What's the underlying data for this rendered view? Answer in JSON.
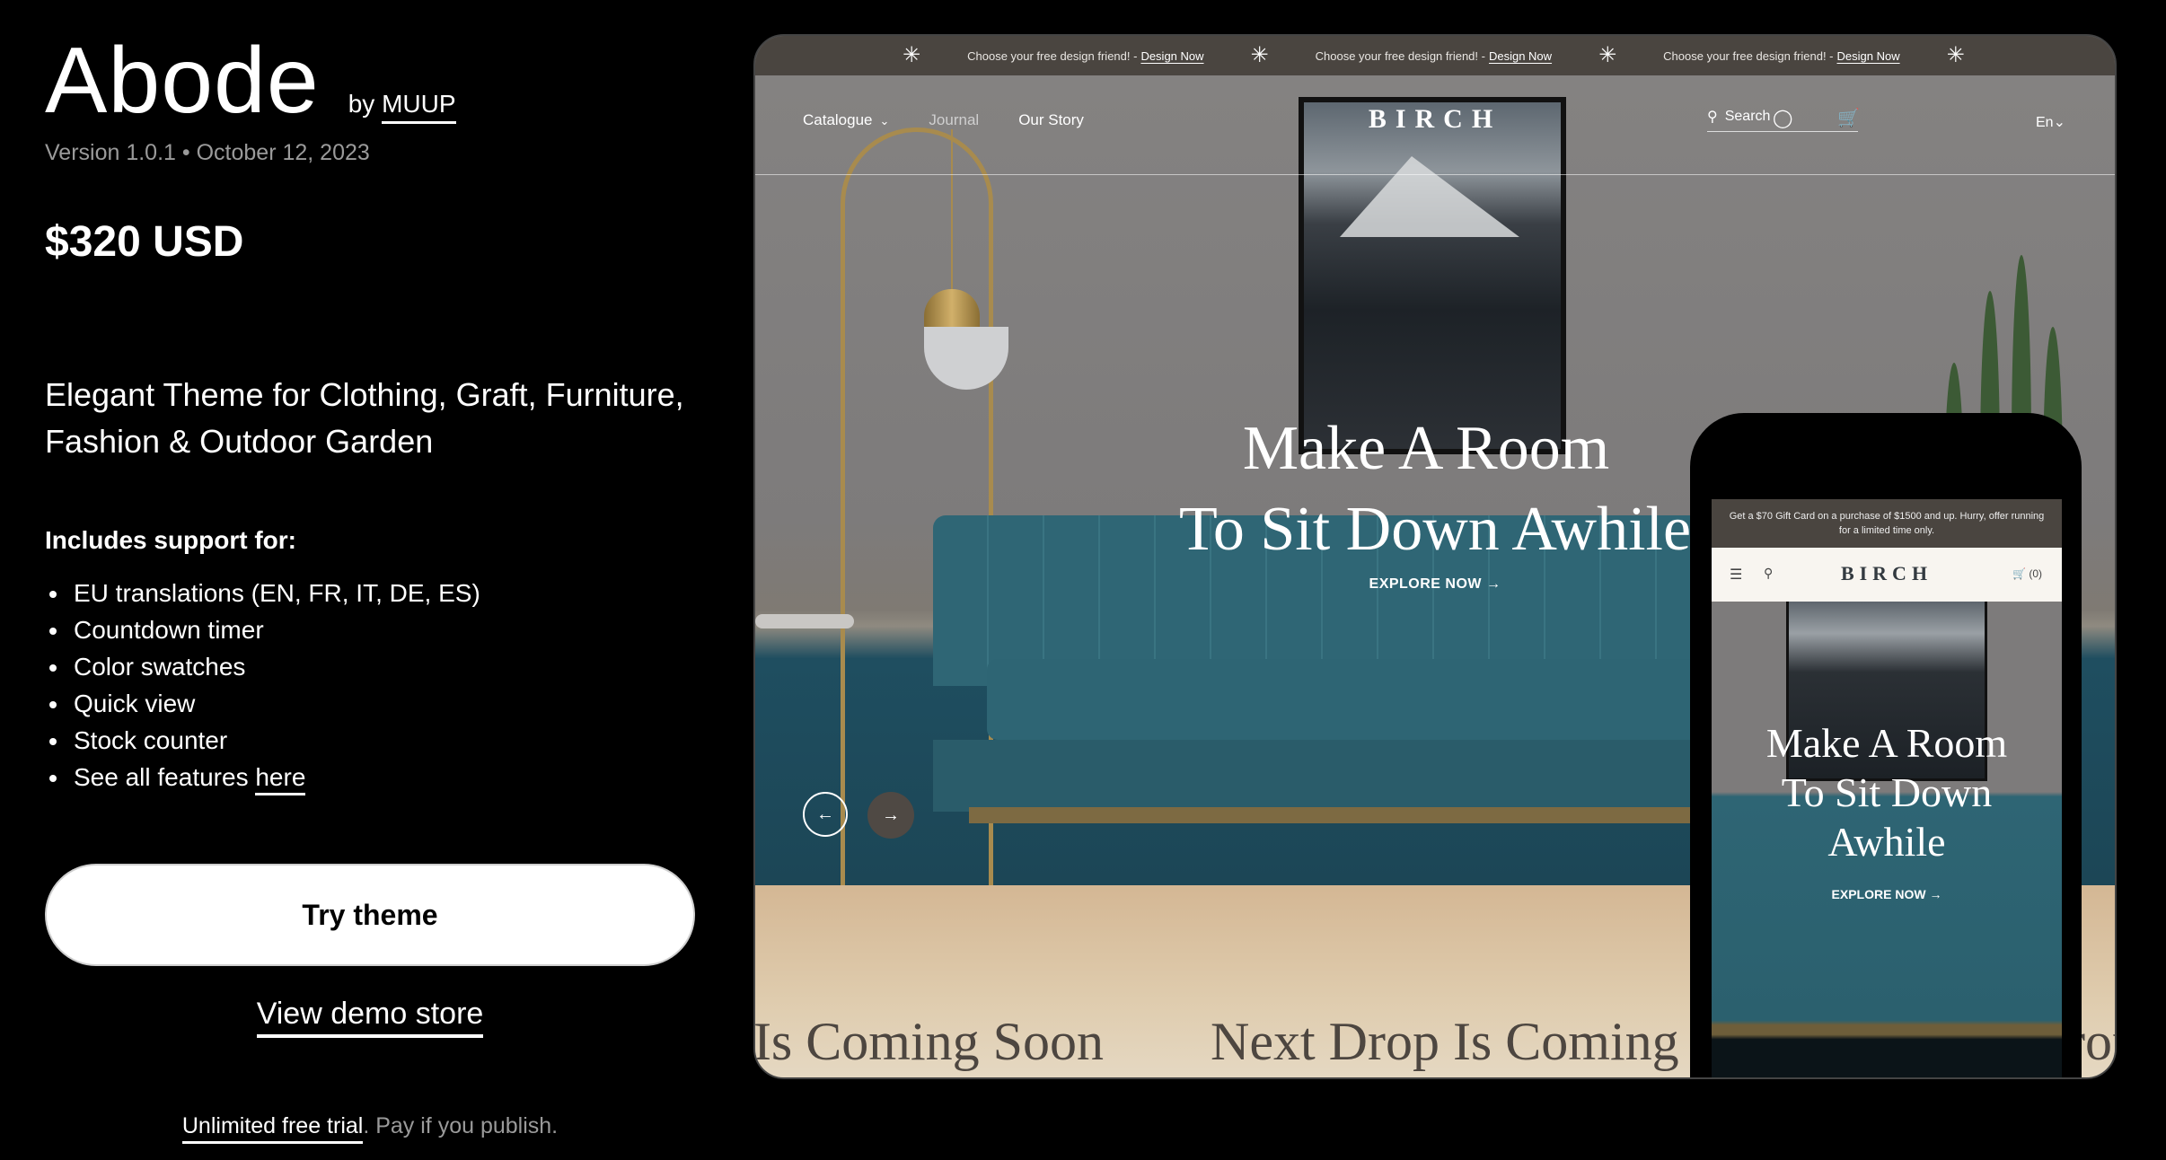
{
  "theme": {
    "name": "Abode",
    "by_prefix": "by",
    "author": "MUUP",
    "version": "Version 1.0.1",
    "separator": "•",
    "date": "October 12, 2023",
    "price": "$320 USD",
    "tagline": "Elegant Theme for Clothing, Graft, Furniture, Fashion & Outdoor Garden"
  },
  "support": {
    "heading": "Includes support for:",
    "features": [
      "EU translations (EN, FR, IT, DE, ES)",
      "Countdown timer",
      "Color swatches",
      "Quick view",
      "Stock counter"
    ],
    "see_all_prefix": "See all features",
    "see_all_link": "here"
  },
  "actions": {
    "try_theme": "Try theme",
    "view_demo": "View demo store",
    "trial_link": "Unlimited free trial",
    "trial_rest": ". Pay if you publish."
  },
  "preview": {
    "announcement": {
      "text": "Choose your free design friend! -",
      "link": "Design Now",
      "repeat_count": 3,
      "star_icon": "✳"
    },
    "nav": {
      "links": [
        "Catalogue",
        "Journal",
        "Our Story"
      ],
      "logo": "BIRCH",
      "search_placeholder": "Search",
      "language": "En"
    },
    "hero": {
      "line1": "Make A Room",
      "line2": "To Sit Down Awhile",
      "cta": "EXPLORE NOW →"
    },
    "marquee": {
      "items": [
        "Next Drop Is Coming Soon",
        "Next Drop Is Coming Soon",
        "Next Drop Is Coming Soon"
      ]
    }
  },
  "phone": {
    "announcement": "Get a $70 Gift Card on a purchase of $1500 and up. Hurry, offer running for a limited time only.",
    "logo": "BIRCH",
    "cart_count": "(0)",
    "hero_lines": [
      "Make A Room",
      "To Sit Down",
      "Awhile"
    ],
    "cta": "EXPLORE NOW →"
  },
  "colors": {
    "page_bg": "#000000",
    "announcement_bg": "#4a4540",
    "marquee_text": "#4d4640",
    "phone_nav_bg": "#f8f5f0",
    "muted_text": "#9a9a9a"
  }
}
